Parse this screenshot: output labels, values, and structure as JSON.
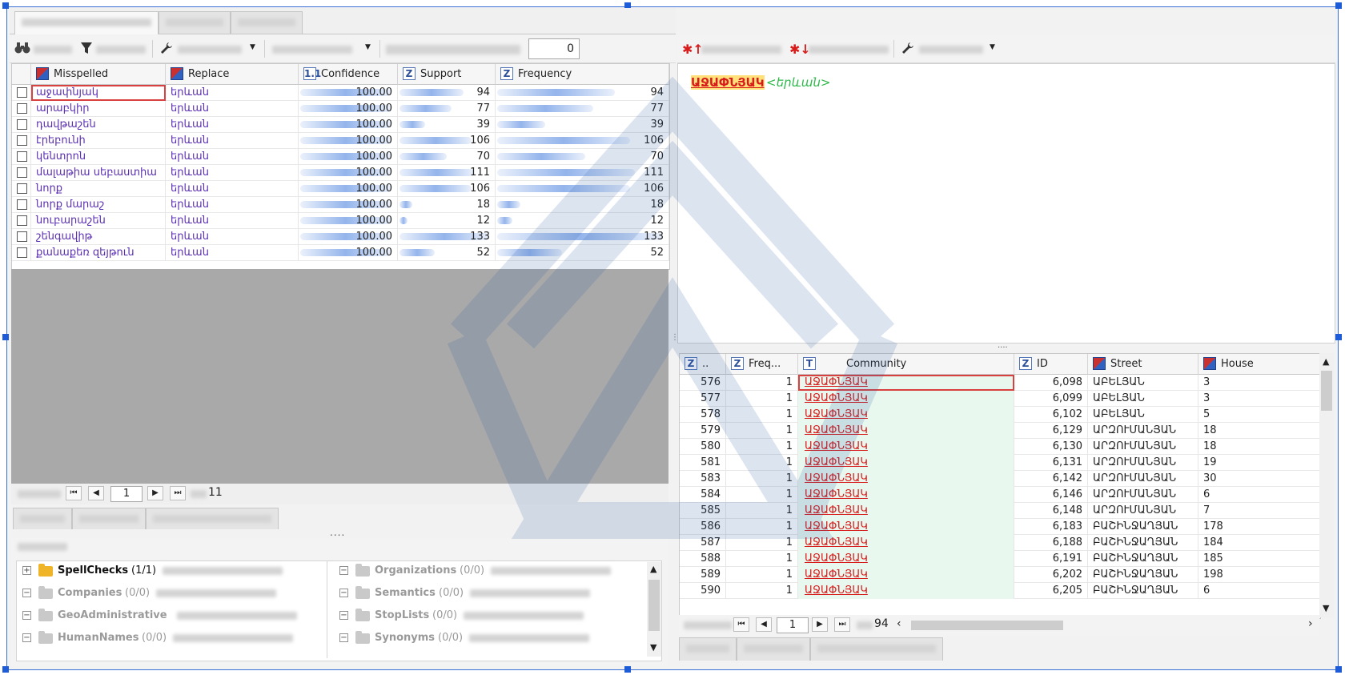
{
  "left_panel": {
    "search_count": "0",
    "grid": {
      "columns": [
        "Misspelled",
        "Replace",
        "Confidence",
        "Support",
        "Frequency"
      ],
      "rows": [
        {
          "misspelled": "աջափնյակ",
          "replace": "երևան",
          "confidence": "100.00",
          "support": "94",
          "frequency": "94",
          "bar": 0.71
        },
        {
          "misspelled": "արաբկիր",
          "replace": "երևան",
          "confidence": "100.00",
          "support": "77",
          "frequency": "77",
          "bar": 0.58
        },
        {
          "misspelled": "դավթաշեն",
          "replace": "երևան",
          "confidence": "100.00",
          "support": "39",
          "frequency": "39",
          "bar": 0.29
        },
        {
          "misspelled": "էրեբունի",
          "replace": "երևան",
          "confidence": "100.00",
          "support": "106",
          "frequency": "106",
          "bar": 0.8
        },
        {
          "misspelled": "կենտրոն",
          "replace": "երևան",
          "confidence": "100.00",
          "support": "70",
          "frequency": "70",
          "bar": 0.53
        },
        {
          "misspelled": "մալաթիա սեբաստիա",
          "replace": "երևան",
          "confidence": "100.00",
          "support": "111",
          "frequency": "111",
          "bar": 0.83
        },
        {
          "misspelled": "նորք",
          "replace": "երևան",
          "confidence": "100.00",
          "support": "106",
          "frequency": "106",
          "bar": 0.8
        },
        {
          "misspelled": "նորք մարաշ",
          "replace": "երևան",
          "confidence": "100.00",
          "support": "18",
          "frequency": "18",
          "bar": 0.14
        },
        {
          "misspelled": "նուբարաշեն",
          "replace": "երևան",
          "confidence": "100.00",
          "support": "12",
          "frequency": "12",
          "bar": 0.09
        },
        {
          "misspelled": "շենգավիթ",
          "replace": "երևան",
          "confidence": "100.00",
          "support": "133",
          "frequency": "133",
          "bar": 1.0
        },
        {
          "misspelled": "քանաքեռ զեյթուն",
          "replace": "երևան",
          "confidence": "100.00",
          "support": "52",
          "frequency": "52",
          "bar": 0.39
        }
      ]
    },
    "pager": {
      "page": "1",
      "total": "11"
    },
    "splitter": "....",
    "tree": {
      "left": [
        {
          "label": "SpellChecks",
          "count": "(1/1)",
          "expander": "+",
          "active": true
        },
        {
          "label": "Companies",
          "count": "(0/0)",
          "expander": "−",
          "active": false
        },
        {
          "label": "GeoAdministrative",
          "count": "",
          "expander": "−",
          "active": false
        },
        {
          "label": "HumanNames",
          "count": "(0/0)",
          "expander": "−",
          "active": false
        }
      ],
      "right": [
        {
          "label": "Organizations",
          "count": "(0/0)",
          "expander": "−"
        },
        {
          "label": "Semantics",
          "count": "(0/0)",
          "expander": "−"
        },
        {
          "label": "StopLists",
          "count": "(0/0)",
          "expander": "−"
        },
        {
          "label": "Synonyms",
          "count": "(0/0)",
          "expander": "−"
        }
      ]
    }
  },
  "right_panel": {
    "preview": {
      "word": "ԱՋԱՓՆՅԱԿ",
      "replacement": "<երևան>"
    },
    "splitter": "....",
    "grid": {
      "columns": [
        "..",
        "Freq...",
        "Community",
        "ID",
        "Street",
        "House"
      ],
      "rows": [
        {
          "n": "576",
          "freq": "1",
          "community": "ԱՋԱՓՆՅԱԿ",
          "id": "6,098",
          "street": "ԱԲԵԼՅԱՆ",
          "house": "3"
        },
        {
          "n": "577",
          "freq": "1",
          "community": "ԱՋԱՓՆՅԱԿ",
          "id": "6,099",
          "street": "ԱԲԵԼՅԱՆ",
          "house": "3"
        },
        {
          "n": "578",
          "freq": "1",
          "community": "ԱՋԱՓՆՅԱԿ",
          "id": "6,102",
          "street": "ԱԲԵԼՅԱՆ",
          "house": "5"
        },
        {
          "n": "579",
          "freq": "1",
          "community": "ԱՋԱՓՆՅԱԿ",
          "id": "6,129",
          "street": "ԱՐԶՈՒՄԱՆՅԱՆ",
          "house": "18"
        },
        {
          "n": "580",
          "freq": "1",
          "community": "ԱՋԱՓՆՅԱԿ",
          "id": "6,130",
          "street": "ԱՐԶՈՒՄԱՆՅԱՆ",
          "house": "18"
        },
        {
          "n": "581",
          "freq": "1",
          "community": "ԱՋԱՓՆՅԱԿ",
          "id": "6,131",
          "street": "ԱՐԶՈՒՄԱՆՅԱՆ",
          "house": "19"
        },
        {
          "n": "583",
          "freq": "1",
          "community": "ԱՋԱՓՆՅԱԿ",
          "id": "6,142",
          "street": "ԱՐԶՈՒՄԱՆՅԱՆ",
          "house": "30"
        },
        {
          "n": "584",
          "freq": "1",
          "community": "ԱՋԱՓՆՅԱԿ",
          "id": "6,146",
          "street": "ԱՐԶՈՒՄԱՆՅԱՆ",
          "house": "6"
        },
        {
          "n": "585",
          "freq": "1",
          "community": "ԱՋԱՓՆՅԱԿ",
          "id": "6,148",
          "street": "ԱՐԶՈՒՄԱՆՅԱՆ",
          "house": "7"
        },
        {
          "n": "586",
          "freq": "1",
          "community": "ԱՋԱՓՆՅԱԿ",
          "id": "6,183",
          "street": "ԲԱՇԻՆՋԱՂՅԱՆ",
          "house": "178"
        },
        {
          "n": "587",
          "freq": "1",
          "community": "ԱՋԱՓՆՅԱԿ",
          "id": "6,188",
          "street": "ԲԱՇԻՆՋԱՂՅԱՆ",
          "house": "184"
        },
        {
          "n": "588",
          "freq": "1",
          "community": "ԱՋԱՓՆՅԱԿ",
          "id": "6,191",
          "street": "ԲԱՇԻՆՋԱՂՅԱՆ",
          "house": "185"
        },
        {
          "n": "589",
          "freq": "1",
          "community": "ԱՋԱՓՆՅԱԿ",
          "id": "6,202",
          "street": "ԲԱՇԻՆՋԱՂՅԱՆ",
          "house": "198"
        },
        {
          "n": "590",
          "freq": "1",
          "community": "ԱՋԱՓՆՅԱԿ",
          "id": "6,205",
          "street": "ԲԱՇԻՆՋԱՂՅԱՆ",
          "house": "6"
        }
      ]
    },
    "pager": {
      "page": "1",
      "total": "94"
    }
  },
  "icons": {
    "binoculars": "binoculars-icon",
    "filter": "filter-icon",
    "wrench": "wrench-icon",
    "sort_asc": "sort-asc-icon",
    "sort_desc": "sort-desc-icon"
  },
  "colors": {
    "selection_border": "#d94040",
    "misspelled_text": "#5b2fb3",
    "community_text": "#d81b1b",
    "replacement_text": "#2db84a",
    "community_bg": "#e8f8ef",
    "frame_border": "#3a6fd8"
  }
}
